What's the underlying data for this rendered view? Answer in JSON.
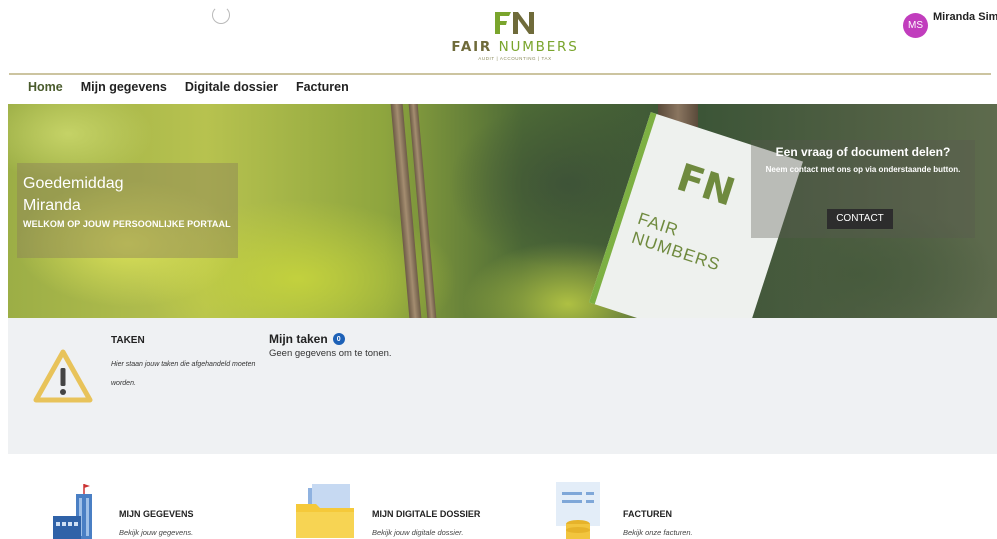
{
  "header": {
    "logo": {
      "mark": "FN",
      "name_part1": "FAIR",
      "name_part2": "NUMBERS",
      "tagline": "AUDIT | ACCOUNTING | TAX"
    },
    "user": {
      "initials": "MS",
      "name": "Miranda Simo"
    }
  },
  "nav": [
    {
      "label": "Home"
    },
    {
      "label": "Mijn gegevens"
    },
    {
      "label": "Digitale dossier"
    },
    {
      "label": "Facturen"
    }
  ],
  "hero": {
    "greeting_line1": "Goedemiddag",
    "greeting_line2": "Miranda",
    "welcome": "WELKOM OP JOUW PERSOONLIJKE PORTAAL",
    "cta_title": "Een vraag of document delen?",
    "cta_text": "Neem contact met ons op via onderstaande button.",
    "cta_button": "CONTACT"
  },
  "tasks": {
    "heading": "TAKEN",
    "description": "Hier staan jouw taken die afgehandeld moeten worden.",
    "my_tasks_label": "Mijn taken",
    "count": "0",
    "empty_text": "Geen gegevens om te tonen."
  },
  "cards": [
    {
      "title": "MIJN GEGEVENS",
      "subtitle": "Bekijk jouw gegevens.",
      "icon": "building-icon"
    },
    {
      "title": "MIJN DIGITALE DOSSIER",
      "subtitle": "Bekijk jouw digitale dossier.",
      "icon": "folder-icon"
    },
    {
      "title": "FACTUREN",
      "subtitle": "Bekijk onze facturen.",
      "icon": "invoice-coins-icon"
    }
  ],
  "colors": {
    "brand_green": "#7aa52d",
    "avatar": "#c13dbd",
    "badge": "#1d61b7",
    "warning": "#e8c35a"
  }
}
